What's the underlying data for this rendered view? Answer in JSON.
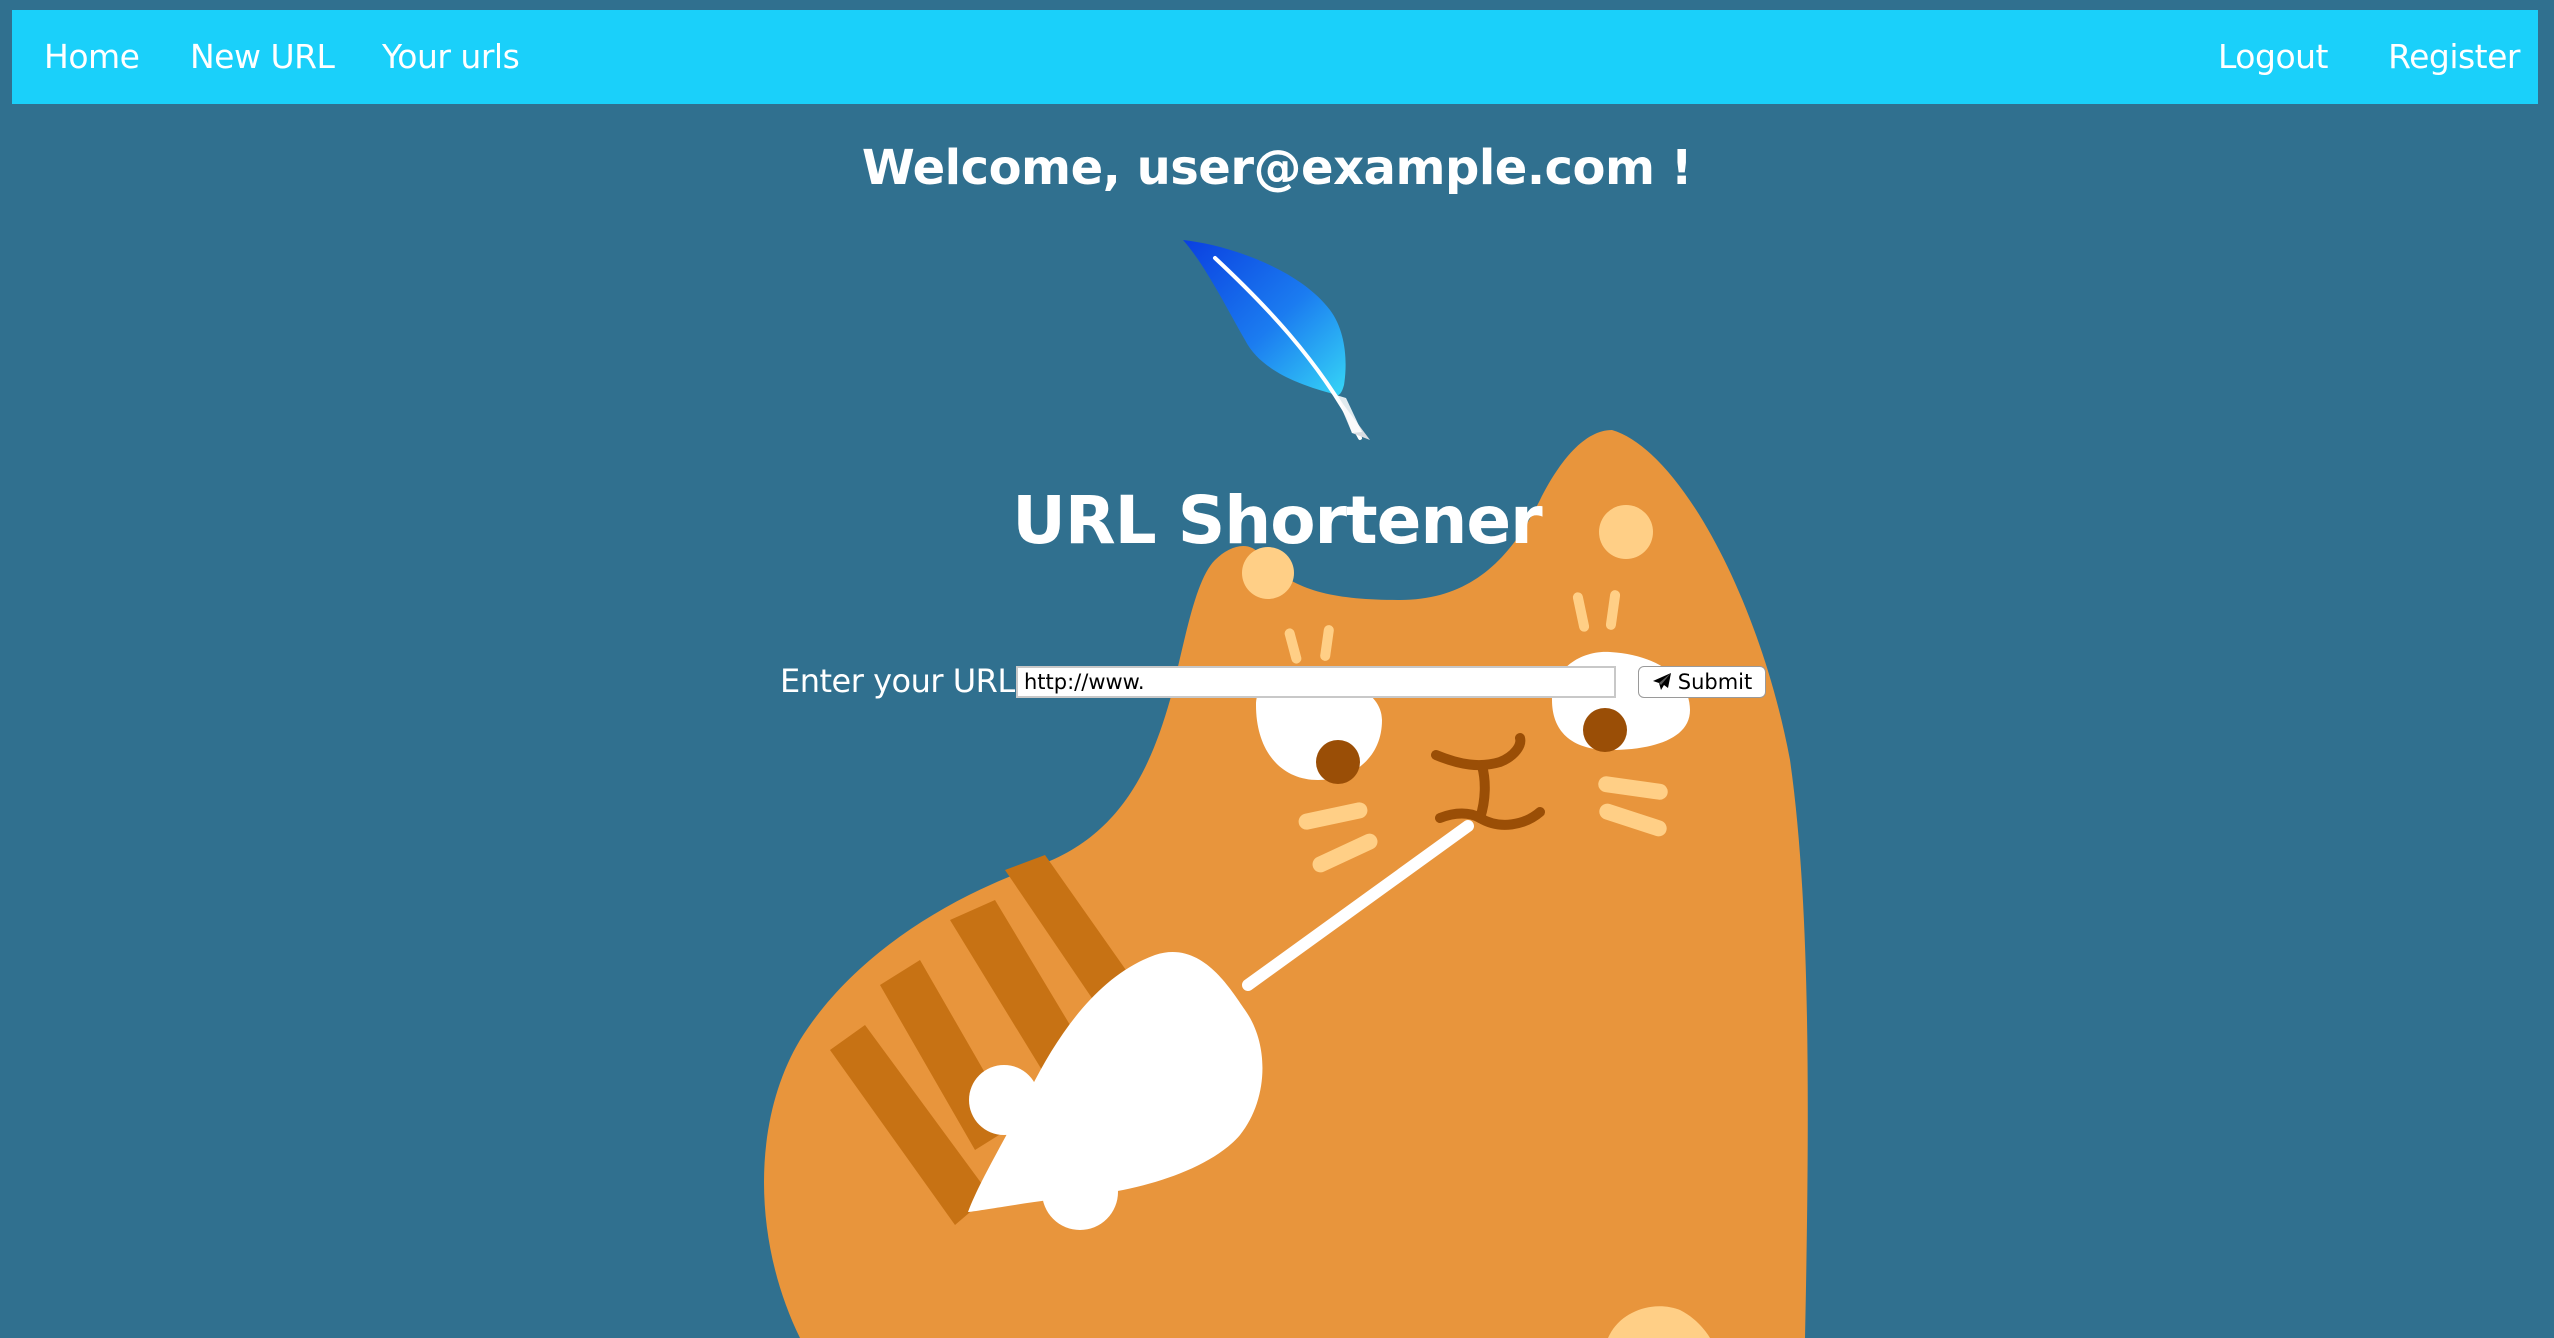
{
  "nav": {
    "left_items": [
      {
        "label": "Home"
      },
      {
        "label": "New URL"
      },
      {
        "label": "Your urls"
      }
    ],
    "right_items": [
      {
        "label": "Logout"
      },
      {
        "label": "Register"
      }
    ]
  },
  "main": {
    "welcome": "Welcome, user@example.com !",
    "logo_icon": "feather-quill-icon",
    "title": "URL Shortener",
    "form": {
      "label": "Enter your URL:",
      "input_value": "http://www.",
      "submit_label": "Submit",
      "submit_icon": "paper-plane-icon"
    },
    "background_art": "orange-cat-with-mouse-toy-illustration"
  },
  "colors": {
    "page_background": "#30708F",
    "navbar_background": "#1AD0FA",
    "cat_orange": "#E8953C",
    "cat_stripe": "#C77214",
    "text": "#FFFFFF"
  }
}
